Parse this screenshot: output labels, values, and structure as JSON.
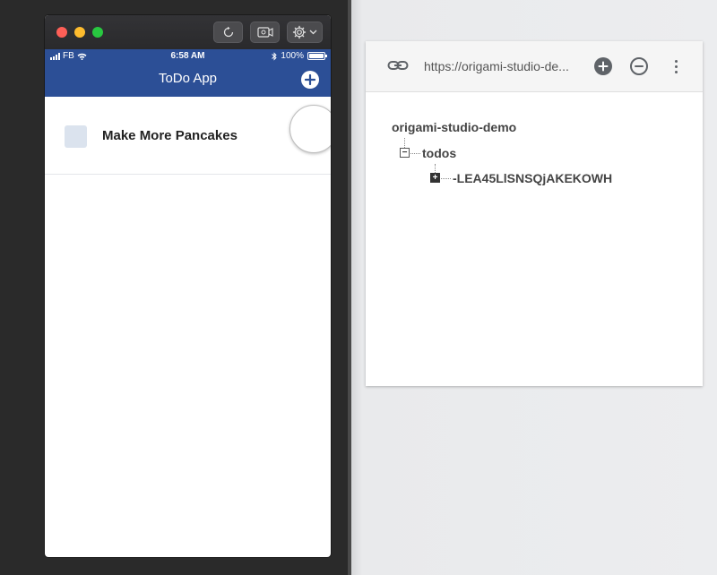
{
  "simulator": {
    "statusbar": {
      "carrier": "FB",
      "time": "6:58 AM",
      "battery": "100%",
      "battery_level": 1.0
    },
    "navbar": {
      "title": "ToDo App",
      "add_icon": "plus-circle-icon"
    },
    "todos": [
      {
        "text": "Make More Pancakes",
        "done": false
      }
    ],
    "toolbar_icons": [
      "reload-icon",
      "record-icon",
      "gear-icon",
      "chevron-down-icon"
    ]
  },
  "firebase": {
    "url": "https://origami-studio-de...",
    "toolbar_icons": [
      "link-icon",
      "plus-circle-icon",
      "minus-circle-icon",
      "more-vert-icon"
    ],
    "tree": {
      "root": "origami-studio-demo",
      "child": "todos",
      "grandchild": "-LEA45LlSNSQjAKEKOWH"
    }
  },
  "colors": {
    "navbar": "#2c4f96",
    "checkbox": "#dbe3ee",
    "traffic_red": "#fe5f57",
    "traffic_yellow": "#febc2e",
    "traffic_green": "#28c840"
  }
}
